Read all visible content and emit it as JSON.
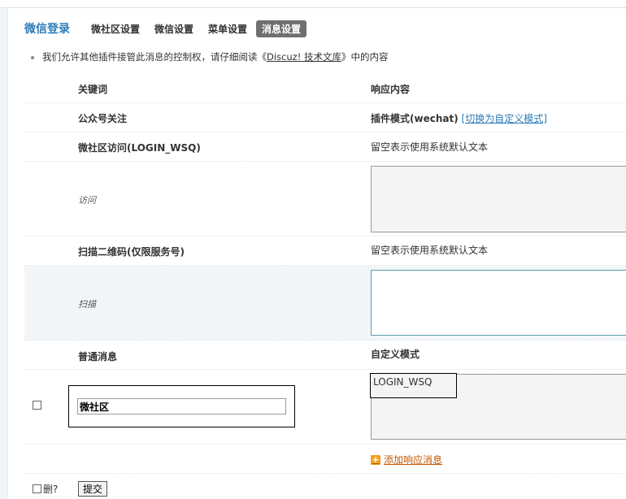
{
  "header": {
    "title": "微信登录",
    "tabs": [
      {
        "label": "微社区设置",
        "active": false
      },
      {
        "label": "微信设置",
        "active": false
      },
      {
        "label": "菜单设置",
        "active": false
      },
      {
        "label": "消息设置",
        "active": true
      }
    ]
  },
  "notice": {
    "prefix": "我们允许其他插件接管此消息的控制权，请仔细阅读《",
    "link": "Discuz! 技术文库",
    "suffix": "》中的内容"
  },
  "table": {
    "col_keyword": "关键词",
    "col_response": "响应内容",
    "follow": {
      "label": "公众号关注",
      "mode": "插件模式(wechat)",
      "switch_link": "[切换为自定义模式]"
    },
    "visit": {
      "label": "微社区访问(LOGIN_WSQ)",
      "hint": "留空表示使用系统默认文本",
      "sublabel": "访问",
      "value": ""
    },
    "scan": {
      "label": "扫描二维码(仅限服务号)",
      "hint": "留空表示使用系统默认文本",
      "sublabel": "扫描",
      "value": ""
    },
    "normal": {
      "label": "普通消息",
      "mode": "自定义模式"
    },
    "message_row": {
      "keyword_value": "微社区",
      "response_value": "LOGIN_WSQ"
    },
    "add_message": "添加响应消息"
  },
  "footer": {
    "delete_label": "删?",
    "submit_label": "提交"
  },
  "colors": {
    "accent": "#2b7bb9",
    "active_tab_bg": "#6f6f6f",
    "add_link": "#c05a00"
  }
}
